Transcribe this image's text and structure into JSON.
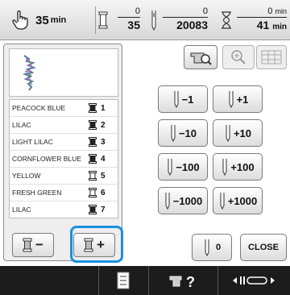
{
  "status": {
    "time_value": "35",
    "time_unit": "min",
    "color_change_current": "0",
    "color_change_total": "35",
    "stitch_current": "0",
    "stitch_total": "20083",
    "sew_time_current": "0",
    "sew_time_current_unit": "min",
    "sew_time_total": "41",
    "sew_time_total_unit": "min"
  },
  "threads": [
    {
      "name": "PEACOCK BLUE",
      "number": "1",
      "spool": "dark"
    },
    {
      "name": "LILAC",
      "number": "2",
      "spool": "dark"
    },
    {
      "name": "LIGHT LILAC",
      "number": "3",
      "spool": "dark"
    },
    {
      "name": "CORNFLOWER BLUE",
      "number": "4",
      "spool": "dark"
    },
    {
      "name": "YELLOW",
      "number": "5",
      "spool": "light"
    },
    {
      "name": "FRESH GREEN",
      "number": "6",
      "spool": "light"
    },
    {
      "name": "LILAC",
      "number": "7",
      "spool": "dark"
    }
  ],
  "spool_buttons": {
    "minus": "−",
    "plus": "+"
  },
  "adjust_buttons": [
    {
      "label": "−1"
    },
    {
      "label": "+1"
    },
    {
      "label": "−10"
    },
    {
      "label": "+10"
    },
    {
      "label": "−100"
    },
    {
      "label": "+100"
    },
    {
      "label": "−1000"
    },
    {
      "label": "+1000"
    }
  ],
  "zero_button": "0",
  "close_button": "CLOSE",
  "colors": {
    "highlight": "#1a8fe0",
    "bottom_bar": "#1c1c1c"
  }
}
